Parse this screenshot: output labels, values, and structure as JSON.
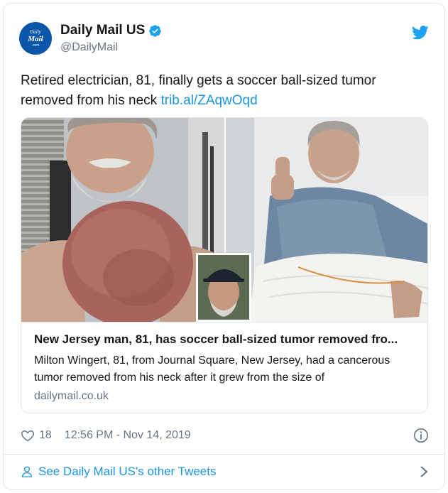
{
  "account": {
    "display_name": "Daily Mail US",
    "handle": "@DailyMail",
    "avatar_text": [
      "Daily",
      "Mail",
      ".com"
    ],
    "verified": true
  },
  "tweet": {
    "text": "Retired electrician, 81, finally gets a soccer ball-sized tumor removed from his neck ",
    "link": "trib.al/ZAqwOqd"
  },
  "card": {
    "title": "New Jersey man, 81, has soccer ball-sized tumor removed fro...",
    "description": "Milton Wingert, 81, from Journal Square, New Jersey, had a cancerous tumor removed from his neck after it grew from the size of",
    "domain": "dailymail.co.uk"
  },
  "meta": {
    "likes": "18",
    "timestamp": "12:56 PM - Nov 14, 2019"
  },
  "footer": {
    "link_text": "See Daily Mail US's other Tweets"
  },
  "icons": {
    "brand": "twitter-bird-icon",
    "verified": "verified-badge-icon",
    "like": "heart-icon",
    "info": "info-icon",
    "profile": "person-icon",
    "more": "chevron-right-icon"
  },
  "colors": {
    "link": "#1b95e0",
    "secondary_text": "#657786",
    "border": "#e1e8ed",
    "avatar_bg": "#0a56a8"
  }
}
